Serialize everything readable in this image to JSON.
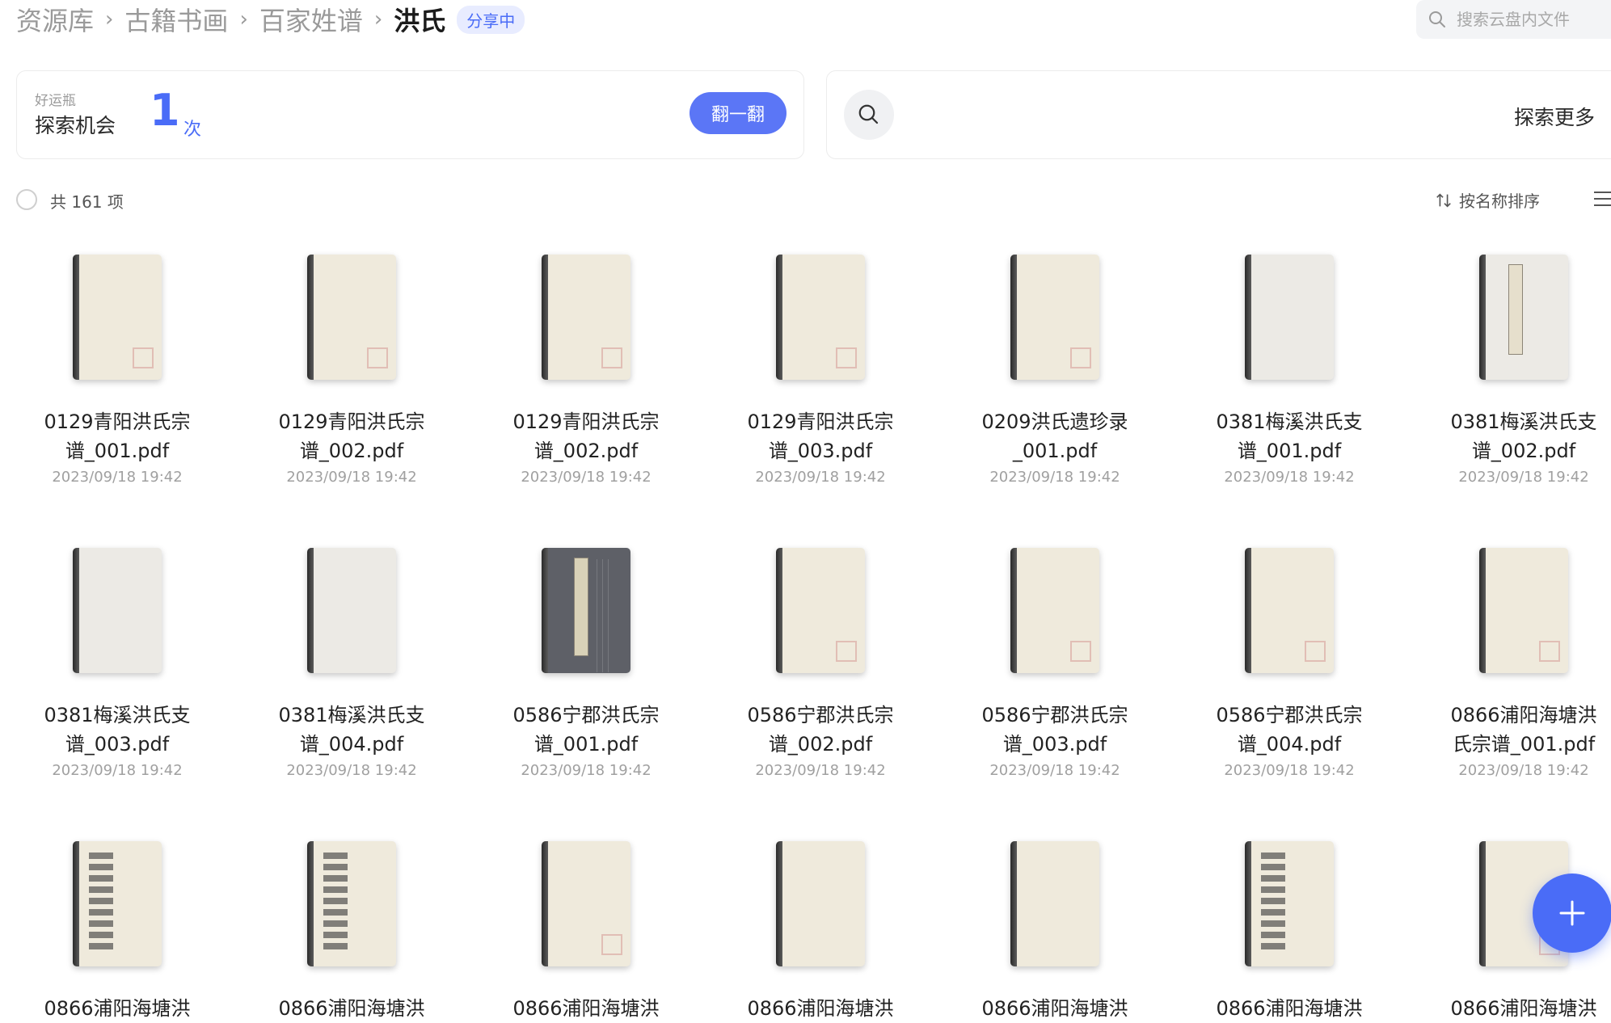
{
  "breadcrumb": {
    "items": [
      "资源库",
      "古籍书画",
      "百家姓谱"
    ],
    "current": "洪氏",
    "badge": "分享中"
  },
  "search": {
    "placeholder": "搜索云盘内文件"
  },
  "lucky": {
    "kicker": "好运瓶",
    "title": "探索机会",
    "count": "1",
    "unit": "次",
    "button": "翻一翻"
  },
  "explore": {
    "label": "探索更多"
  },
  "toolbar": {
    "count_text": "共 161 项",
    "sort_label": "按名称排序"
  },
  "files": [
    {
      "name": "0129青阳洪氏宗谱_001.pdf",
      "date": "2023/09/18 19:42"
    },
    {
      "name": "0129青阳洪氏宗谱_002.pdf",
      "date": "2023/09/18 19:42"
    },
    {
      "name": "0129青阳洪氏宗谱_002.pdf",
      "date": "2023/09/18 19:42"
    },
    {
      "name": "0129青阳洪氏宗谱_003.pdf",
      "date": "2023/09/18 19:42"
    },
    {
      "name": "0209洪氏遗珍录_001.pdf",
      "date": "2023/09/18 19:42"
    },
    {
      "name": "0381梅溪洪氏支谱_001.pdf",
      "date": "2023/09/18 19:42"
    },
    {
      "name": "0381梅溪洪氏支谱_002.pdf",
      "date": "2023/09/18 19:42"
    },
    {
      "name": "0381梅溪洪氏支谱_003.pdf",
      "date": "2023/09/18 19:42"
    },
    {
      "name": "0381梅溪洪氏支谱_004.pdf",
      "date": "2023/09/18 19:42"
    },
    {
      "name": "0586宁郡洪氏宗谱_001.pdf",
      "date": "2023/09/18 19:42"
    },
    {
      "name": "0586宁郡洪氏宗谱_002.pdf",
      "date": "2023/09/18 19:42"
    },
    {
      "name": "0586宁郡洪氏宗谱_003.pdf",
      "date": "2023/09/18 19:42"
    },
    {
      "name": "0586宁郡洪氏宗谱_004.pdf",
      "date": "2023/09/18 19:42"
    },
    {
      "name": "0866浦阳海塘洪氏宗谱_001.pdf",
      "date": "2023/09/18 19:42"
    },
    {
      "name": "0866浦阳海塘洪",
      "date": ""
    },
    {
      "name": "0866浦阳海塘洪",
      "date": ""
    },
    {
      "name": "0866浦阳海塘洪",
      "date": ""
    },
    {
      "name": "0866浦阳海塘洪",
      "date": ""
    },
    {
      "name": "0866浦阳海塘洪",
      "date": ""
    },
    {
      "name": "0866浦阳海塘洪",
      "date": ""
    },
    {
      "name": "0866浦阳海塘洪",
      "date": ""
    }
  ],
  "icons": {
    "search": "search-icon",
    "explore": "search-icon",
    "sort": "sort-icon",
    "list": "list-view-icon",
    "fab": "plus-icon"
  },
  "colors": {
    "accent": "#4a6cf7",
    "button": "#5b76f6",
    "badge_bg": "#e8ecff"
  }
}
